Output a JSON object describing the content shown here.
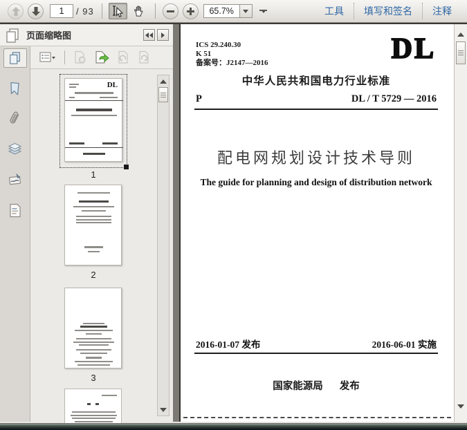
{
  "toolbar": {
    "page_number": "1",
    "page_total": "/ 93",
    "zoom_level": "65.7%",
    "tools_label": "工具",
    "fill_sign_label": "填写和签名",
    "comment_label": "注释"
  },
  "sidebar": {
    "panel_title": "页面缩略图",
    "thumbnails": [
      {
        "label": "1"
      },
      {
        "label": "2"
      },
      {
        "label": "3"
      }
    ]
  },
  "document": {
    "ics": "ICS 29.240.30",
    "k_class": "K 51",
    "record_no": "备案号：J2147—2016",
    "logo": "DL",
    "standard_header": "中华人民共和国电力行业标准",
    "class_letter": "P",
    "standard_no": "DL / T  5729 — 2016",
    "title_cn": "配电网规划设计技术导则",
    "title_en": "The guide for planning and design of distribution network",
    "issue_date": "2016-01-07  发布",
    "impl_date": "2016-06-01  实施",
    "publisher": "国家能源局",
    "publish_label": "发布"
  }
}
